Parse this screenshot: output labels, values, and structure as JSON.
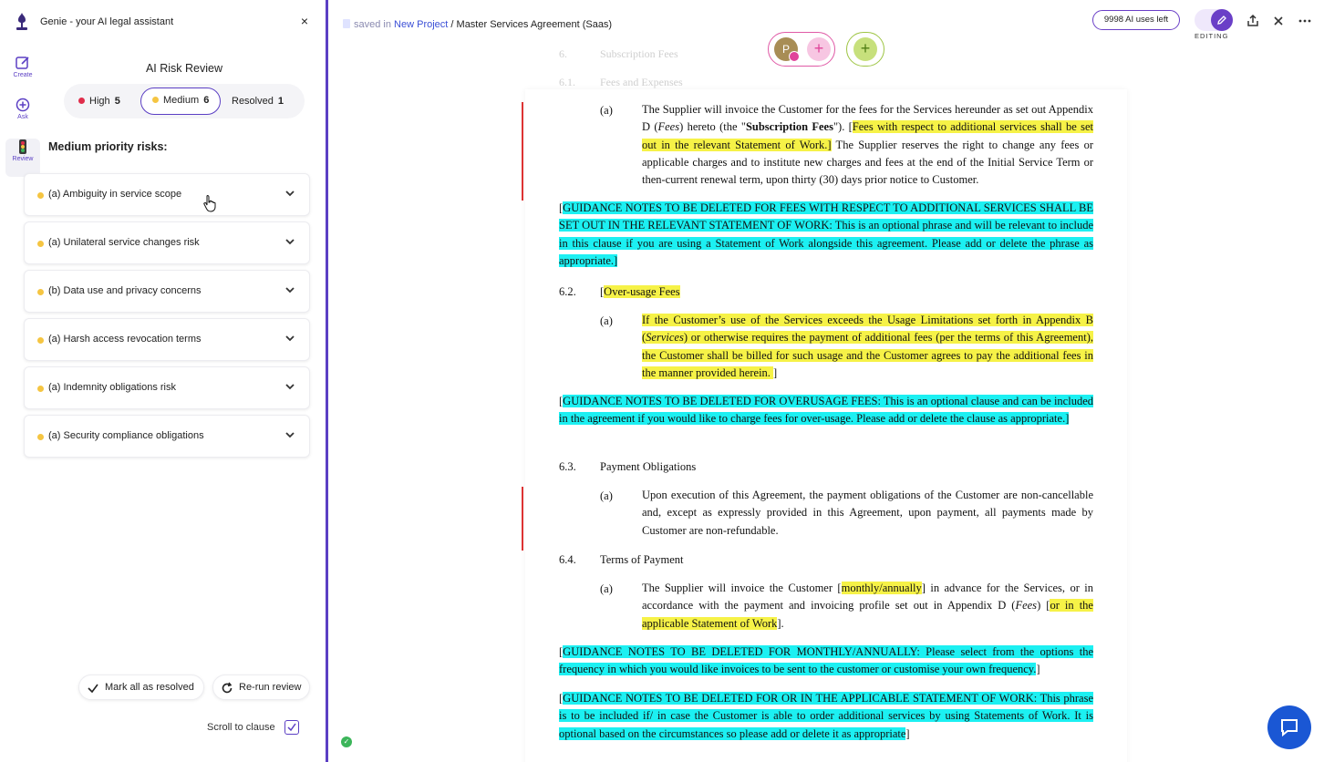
{
  "panel": {
    "title": "Genie - your AI legal assistant",
    "close": "×",
    "rail": [
      {
        "label": "Create",
        "icon": "create-icon"
      },
      {
        "label": "Ask",
        "icon": "ask-icon"
      },
      {
        "label": "Review",
        "icon": "review-icon"
      }
    ],
    "review_title": "AI Risk Review",
    "filters": {
      "high_label": "High",
      "high_count": "5",
      "medium_label": "Medium",
      "medium_count": "6",
      "resolved_label": "Resolved",
      "resolved_count": "1",
      "high_color": "#e02d4b",
      "medium_color": "#f5c542"
    },
    "section_title": "Medium priority risks:",
    "risks": [
      "(a) Ambiguity in service scope",
      "(a) Unilateral service changes risk",
      "(b) Data use and privacy concerns",
      "(a) Harsh access revocation terms",
      "(a) Indemnity obligations risk",
      "(a) Security compliance obligations"
    ],
    "mark_all": "Mark all as resolved",
    "rerun": "Re-run review",
    "scroll_to_clause": "Scroll to clause"
  },
  "topbar": {
    "saved_in": "saved in",
    "project": "New Project",
    "separator": "/",
    "doc_name": "Master Services Agreement (Saas)",
    "avatar_initial": "P",
    "ai_uses": "9998 AI uses left",
    "editing": "EDITING",
    "accent": "#6a3fc7"
  },
  "doc": {
    "faded_top_num": "6.",
    "faded_top": "Subscription Fees",
    "faded_61": "6.1.",
    "faded_61_title": "Fees and Expenses",
    "p1_num": "(a)",
    "p1_a": "The Supplier will invoice the Customer for the fees for the Services hereunder as set out Appendix D (",
    "p1_fees": "Fees",
    "p1_b": ") hereto (the \"",
    "p1_bold": "Subscription Fees",
    "p1_c": "\"). [",
    "p1_hl": "Fees with respect to additional services shall be set out in the relevant Statement of Work.]",
    "p1_d": " The Supplier reserves the right to change any fees or applicable charges and to institute new charges and fees at the end of the Initial Service Term or then-current renewal term, upon thirty (30) days prior notice to Customer.",
    "g1_open": "[",
    "g1": "GUIDANCE NOTES TO BE DELETED FOR FEES WITH RESPECT TO ADDITIONAL SERVICES SHALL BE SET OUT IN THE RELEVANT STATEMENT OF WORK: This is an optional phrase and will be relevant to include in this clause if you are using a Statement of Work alongside this agreement. Please add or delete the phrase as appropriate.]",
    "s62_num": "6.2.",
    "s62_open": "[",
    "s62_title": "Over-usage Fees",
    "p2_num": "(a)",
    "p2_hl_a": "If the Customer’s use of the Services exceeds the Usage Limitations set forth in Appendix B (",
    "p2_services": "Services",
    "p2_hl_b": ") or otherwise requires the payment of additional fees (per the terms of this Agreement), the Customer shall be billed for such usage and the Customer agrees to pay the additional fees in the manner provided herein. ",
    "p2_close": " ]",
    "g2_open": "[",
    "g2": "GUIDANCE NOTES TO BE DELETED FOR OVERUSAGE FEES: This is an optional clause and can be included in the agreement if you would like to charge fees for over-usage. Please add or delete the clause as appropriate.]",
    "s63_num": "6.3.",
    "s63_title": "Payment Obligations",
    "p3_num": "(a)",
    "p3": "Upon execution of this Agreement, the payment obligations of the Customer are non-cancellable and, except as expressly provided in this Agreement, upon payment, all payments made by Customer are non-refundable.",
    "s64_num": "6.4.",
    "s64_title": "Terms of Payment",
    "p4_num": "(a)",
    "p4_a": "The Supplier will invoice the Customer [",
    "p4_hl1": "monthly/annually",
    "p4_b": "] in advance for the Services, or in accordance with the payment and invoicing profile set out in Appendix D (",
    "p4_fees": "Fees",
    "p4_c": ") [",
    "p4_hl2": "or in the applicable Statement of Work",
    "p4_d": "].",
    "g3_open": "[",
    "g3": "GUIDANCE NOTES TO BE DELETED FOR MONTHLY/ANNUALLY: Please select from the options the frequency in which you would like invoices to be sent to the customer or customise your own frequency.",
    "g3_close": "]",
    "g4_open": "[",
    "g4": "GUIDANCE NOTES TO BE DELETED FOR OR IN THE APPLICABLE STATEMENT OF WORK: This phrase is to be included if/ in case the Customer is able to order additional services by using Statements of Work. It is optional based on the circumstances so please add or delete it as appropriate",
    "g4_close": "]",
    "highlight_yellow": "#f6f247",
    "highlight_cyan": "#1cf0f2",
    "change_bar_color": "#dd3333"
  }
}
